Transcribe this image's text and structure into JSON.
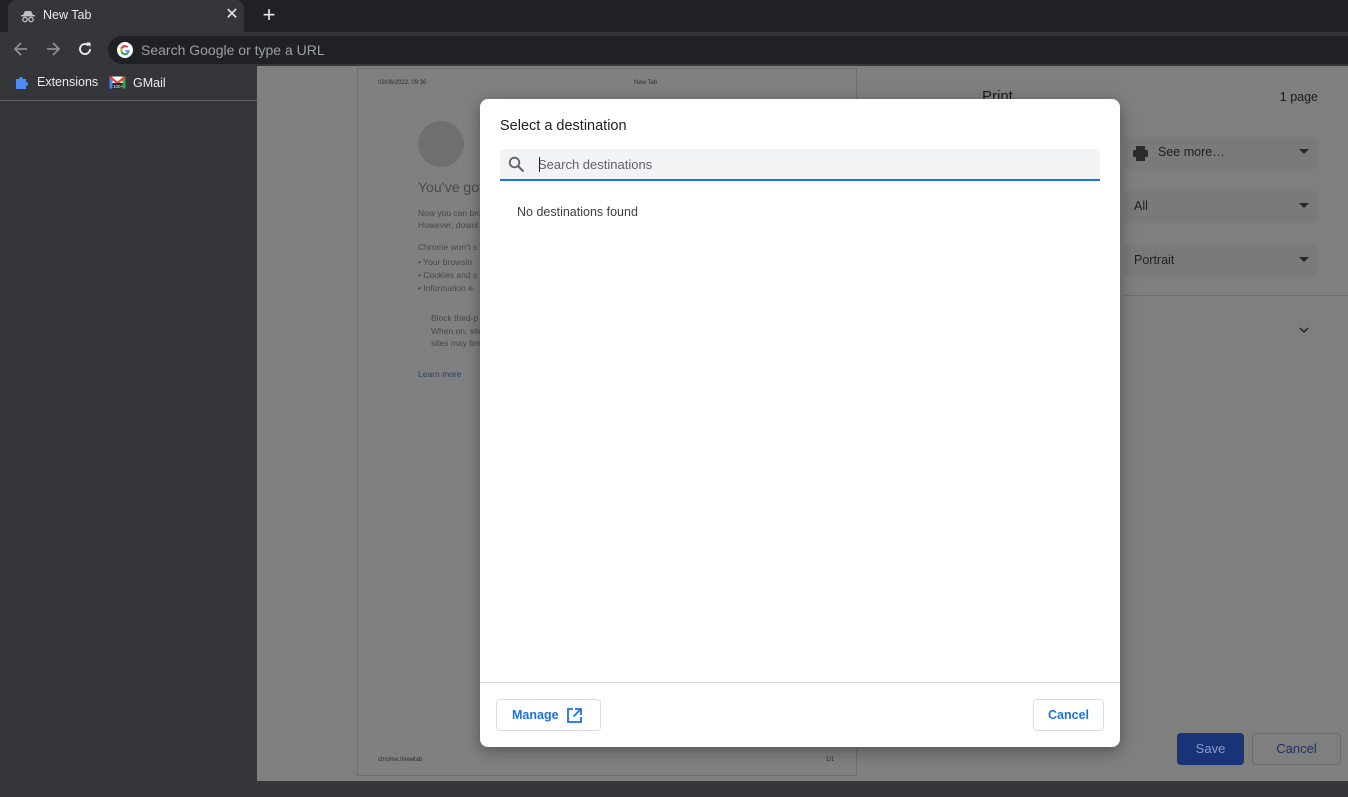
{
  "tab": {
    "title": "New Tab",
    "icon": "incognito-icon"
  },
  "omnibox": {
    "placeholder": "Search Google or type a URL"
  },
  "bookmarks": [
    {
      "label": "Extensions",
      "icon": "puzzle-icon"
    },
    {
      "label": "GMail",
      "icon": "gmail-icon"
    }
  ],
  "preview_page": {
    "header_date": "03/06/2022, 09:36",
    "header_title": "New Tab",
    "heading": "You’ve got",
    "line1": "Now you can bro",
    "line2": "However, downl",
    "line3": "Chrome won’t s",
    "bullet1": "•  Your browsin",
    "bullet2": "•  Cookies and s",
    "bullet3": "•  Information e",
    "block1": "Block third-p",
    "block2": "When on, site",
    "block3": "sites may bre",
    "learn_more": "Learn more",
    "footer_url": "chrome://newtab",
    "footer_page": "1/1"
  },
  "print_settings": {
    "title": "Print",
    "pages_count": "1 page",
    "destination_value": "See more…",
    "pages_value": "All",
    "layout_value": "Portrait",
    "save_label": "Save",
    "cancel_label": "Cancel"
  },
  "dialog": {
    "title": "Select a destination",
    "search_placeholder": "Search destinations",
    "empty_message": "No destinations found",
    "manage_label": "Manage",
    "cancel_label": "Cancel",
    "accent_color": "#1a73e8"
  }
}
